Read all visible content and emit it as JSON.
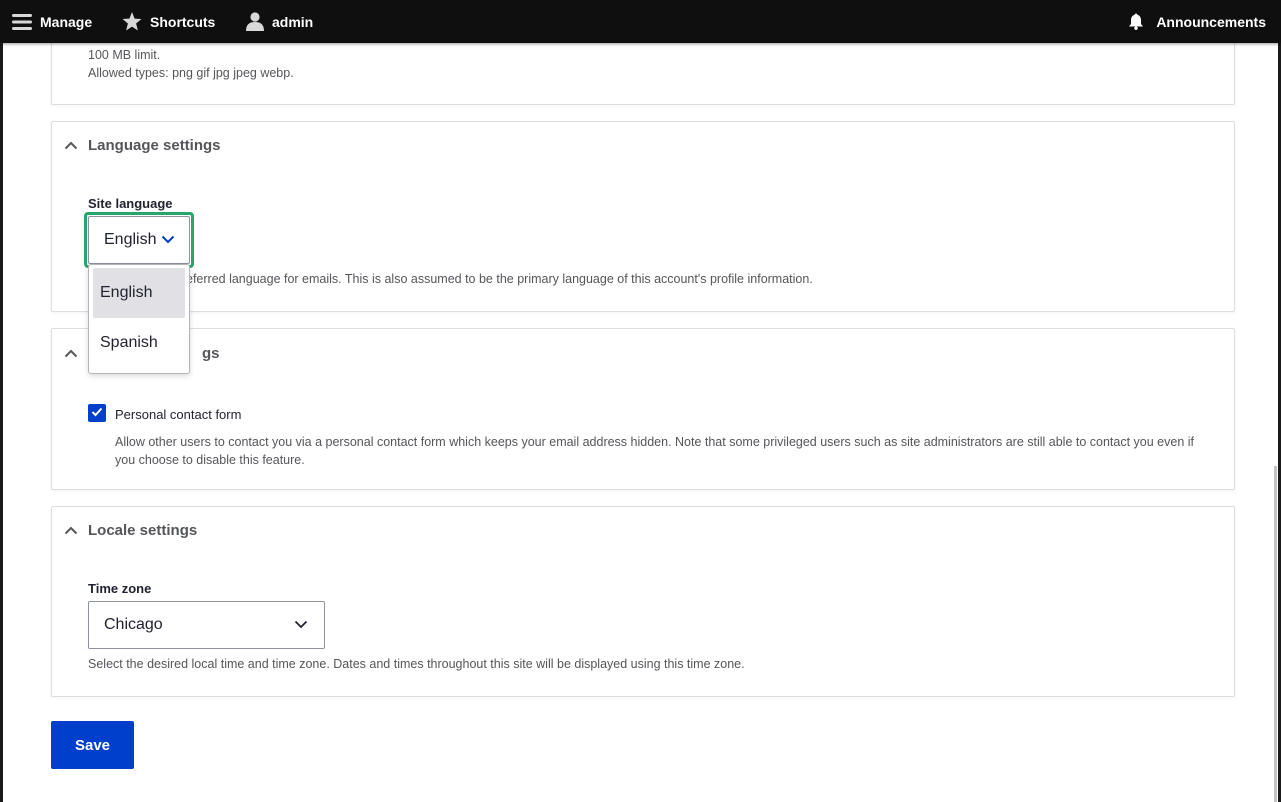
{
  "toolbar": {
    "manage": "Manage",
    "shortcuts": "Shortcuts",
    "user": "admin",
    "announcements": "Announcements"
  },
  "picture": {
    "size_limit": "100 MB limit.",
    "allowed_types": "Allowed types: png gif jpg jpeg webp."
  },
  "language": {
    "summary": "Language settings",
    "site_language_label": "Site language",
    "selected": "English",
    "description_visible": "eferred language for emails. This is also assumed to be the primary language of this account's profile information.",
    "options": [
      "English",
      "Spanish"
    ]
  },
  "contact": {
    "summary_visible": "gs",
    "checkbox_label": "Personal contact form",
    "checked": true,
    "description": "Allow other users to contact you via a personal contact form which keeps your email address hidden. Note that some privileged users such as site administrators are still able to contact you even if you choose to disable this feature."
  },
  "locale": {
    "summary": "Locale settings",
    "timezone_label": "Time zone",
    "timezone_value": "Chicago",
    "description": "Select the desired local time and time zone. Dates and times throughout this site will be displayed using this time zone."
  },
  "actions": {
    "save": "Save"
  },
  "colors": {
    "toolbar_bg": "#0f0f0f",
    "primary_button": "#003ecc",
    "focus_ring": "#26a769",
    "text_muted": "#55565b"
  }
}
